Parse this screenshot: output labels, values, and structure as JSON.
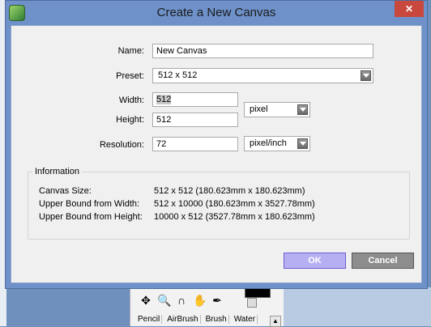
{
  "dialog": {
    "title": "Create a New Canvas",
    "close_label": "✕"
  },
  "form": {
    "name_label": "Name:",
    "name_value": "New Canvas",
    "preset_label": "Preset:",
    "preset_value": "512 x  512",
    "width_label": "Width:",
    "width_value": "512",
    "height_label": "Height:",
    "height_value": "512",
    "size_unit": "pixel",
    "resolution_label": "Resolution:",
    "resolution_value": "72",
    "resolution_unit": "pixel/inch"
  },
  "info": {
    "title": "Information",
    "rows": [
      {
        "key": "Canvas Size:",
        "value": "512 x 512 (180.623mm x 180.623mm)"
      },
      {
        "key": "Upper Bound from Width:",
        "value": "512 x 10000 (180.623mm x 3527.78mm)"
      },
      {
        "key": "Upper Bound from Height:",
        "value": "10000 x 512 (3527.78mm x 180.623mm)"
      }
    ]
  },
  "buttons": {
    "ok": "OK",
    "cancel": "Cancel"
  },
  "background": {
    "tools": [
      "✥",
      "🔍",
      "∩",
      "✋",
      "✒"
    ],
    "brush_tabs": [
      "Pencil",
      "AirBrush",
      "Brush",
      "Water"
    ]
  }
}
